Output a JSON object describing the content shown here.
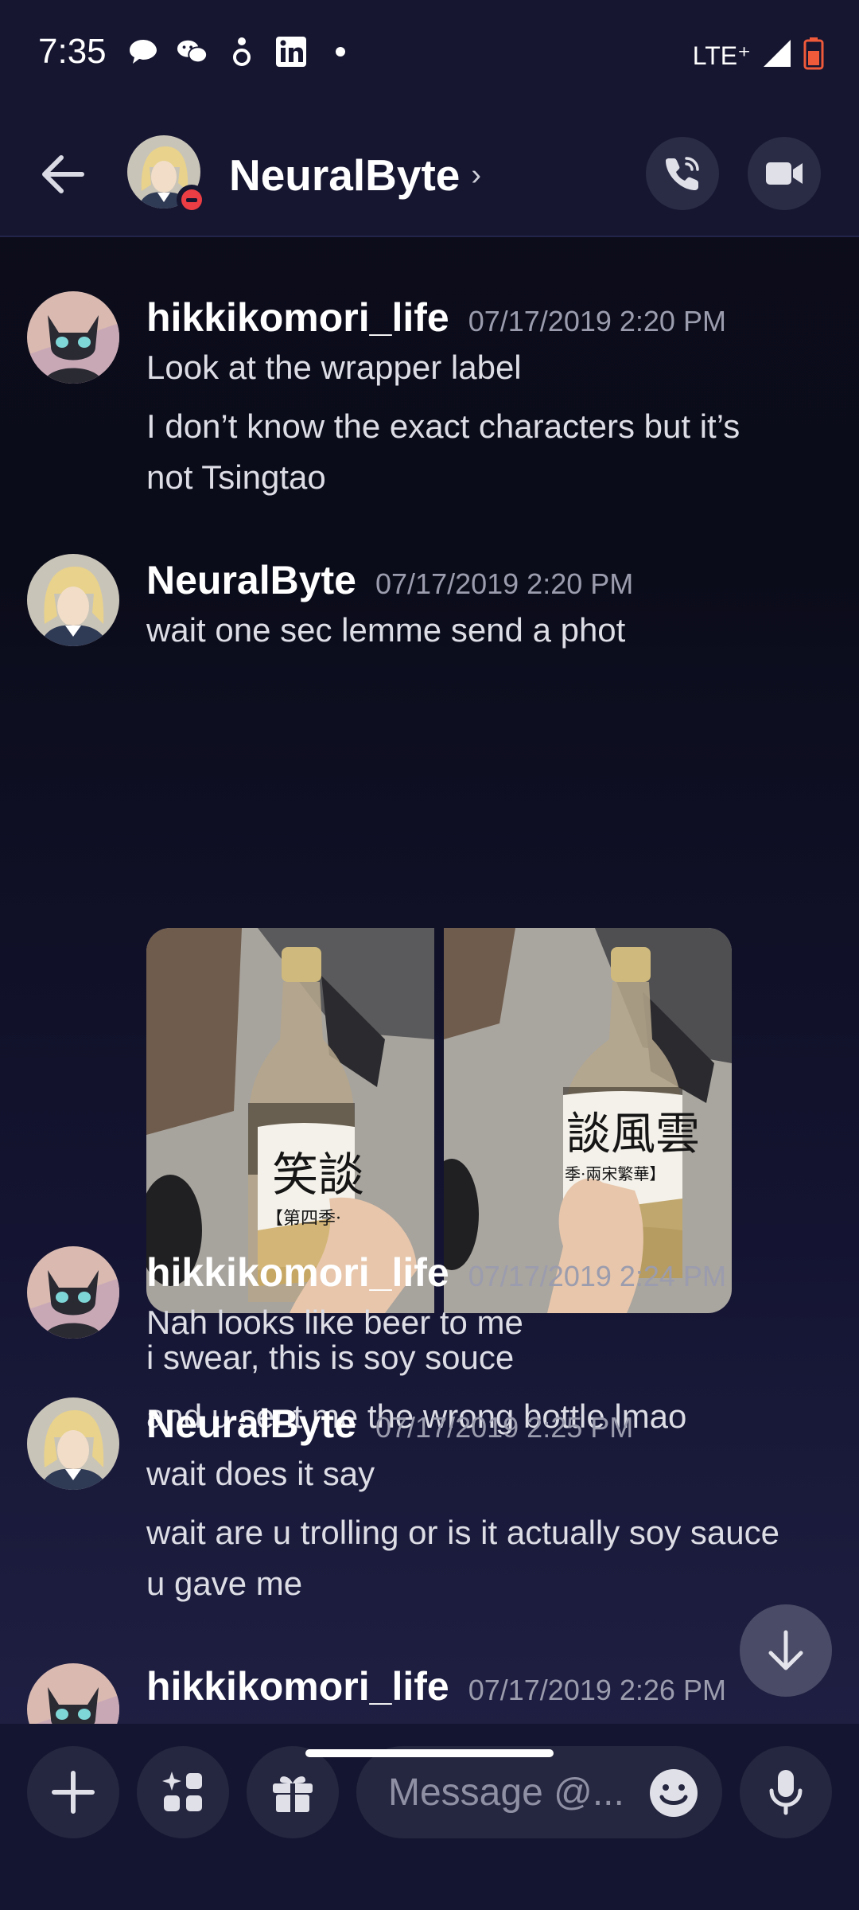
{
  "status_bar": {
    "time": "7:35",
    "network": "LTE⁺",
    "notification_icons": [
      "chat-bubble-icon",
      "wechat-icon",
      "dot-app-icon",
      "linkedin-icon",
      "more-dot-icon"
    ]
  },
  "header": {
    "title": "NeuralByte",
    "chevron": "›",
    "status": "do-not-disturb"
  },
  "messages": [
    {
      "author": "hikkikomori_life",
      "timestamp": "07/17/2019 2:20 PM",
      "lines": [
        "Look at the wrapper label",
        "I don’t know the exact characters but it’s",
        "not Tsingtao"
      ]
    },
    {
      "author": "NeuralByte",
      "timestamp": "07/17/2019 2:20 PM",
      "lines": [
        "wait one sec lemme send a phot",
        "i swear, this is soy souce",
        "and u sent me the wrong bottle lmao"
      ],
      "photos": [
        {
          "label_text": "笑談",
          "sub_text": "【第四季·"
        },
        {
          "label_text": "談風雲",
          "sub_text": "季·兩宋繁華】"
        }
      ]
    },
    {
      "author": "hikkikomori_life",
      "timestamp": "07/17/2019 2:24 PM",
      "lines": [
        "Nah looks like beer to me"
      ]
    },
    {
      "author": "NeuralByte",
      "timestamp": "07/17/2019 2:25 PM",
      "lines": [
        "wait does it say",
        "wait are u trolling or is it actually soy sauce",
        "u gave me"
      ]
    },
    {
      "author": "hikkikomori_life",
      "timestamp": "07/17/2019 2:26 PM",
      "lines": []
    }
  ],
  "composer": {
    "placeholder": "Message @..."
  },
  "colors": {
    "accent_red": "#ea3d44",
    "background": "#0c0d1c",
    "button": "#25263f"
  }
}
